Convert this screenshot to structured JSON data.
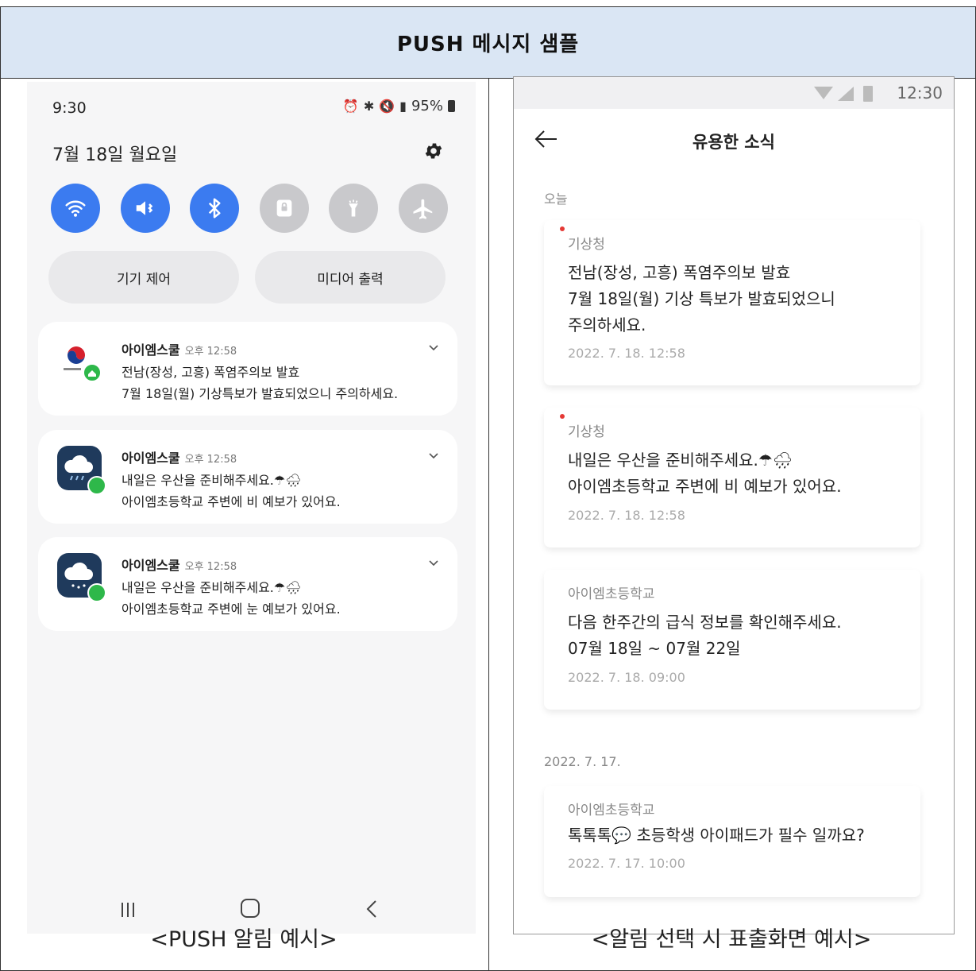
{
  "header": {
    "title": "PUSH 메시지 샘플"
  },
  "captions": {
    "left": "<PUSH 알림 예시>",
    "right": "<알림 선택 시 표출화면 예시>"
  },
  "left_phone": {
    "status": {
      "time": "9:30",
      "battery": "95%"
    },
    "date": "7월 18일 월요일",
    "quick_toggles": [
      {
        "icon": "wifi-icon",
        "state": "on"
      },
      {
        "icon": "mute-icon",
        "state": "on"
      },
      {
        "icon": "bluetooth-icon",
        "state": "on"
      },
      {
        "icon": "lock-icon",
        "state": "off"
      },
      {
        "icon": "flashlight-icon",
        "state": "off"
      },
      {
        "icon": "airplane-icon",
        "state": "off"
      }
    ],
    "pills": {
      "device_control": "기기 제어",
      "media_output": "미디어 출력"
    },
    "notifications": [
      {
        "app": "아이엠스쿨",
        "time": "오후 12:58",
        "line1": "전남(장성, 고흥) 폭염주의보 발효",
        "line2": "7월 18일(월) 기상특보가 발효되었으니 주의하세요.",
        "icon": "kma-logo-icon"
      },
      {
        "app": "아이엠스쿨",
        "time": "오후 12:58",
        "line1": "내일은 우산을 준비해주세요.☂🌧",
        "line2": "아이엠초등학교 주변에 비 예보가 있어요.",
        "icon": "cloud-rain-icon"
      },
      {
        "app": "아이엠스쿨",
        "time": "오후 12:58",
        "line1": "내일은 우산을 준비해주세요.☂🌧",
        "line2": "아이엠초등학교 주변에 눈 예보가 있어요.",
        "icon": "cloud-snow-icon"
      }
    ]
  },
  "right_phone": {
    "status_time": "12:30",
    "title": "유용한 소식",
    "sections": [
      {
        "label": "오늘"
      },
      {
        "label": "2022. 7. 17."
      }
    ],
    "cards": [
      {
        "sender": "기상청",
        "lines": [
          "전남(장성, 고흥) 폭염주의보 발효",
          "7월 18일(월) 기상 특보가 발효되었으니",
          "주의하세요."
        ],
        "date": "2022. 7. 18. 12:58",
        "unread": true
      },
      {
        "sender": "기상청",
        "lines": [
          "내일은 우산을 준비해주세요.☂🌧",
          "아이엠초등학교 주변에 비 예보가 있어요."
        ],
        "date": "2022. 7. 18. 12:58",
        "unread": true
      },
      {
        "sender": "아이엠초등학교",
        "lines": [
          "다음 한주간의 급식 정보를 확인해주세요.",
          "07월 18일 ~ 07월 22일"
        ],
        "date": "2022. 7. 18. 09:00",
        "unread": false
      },
      {
        "sender": "아이엠초등학교",
        "lines": [
          "톡톡톡💬 초등학생 아이패드가 필수 일까요?"
        ],
        "date": "2022. 7. 17. 10:00",
        "unread": false
      }
    ]
  }
}
